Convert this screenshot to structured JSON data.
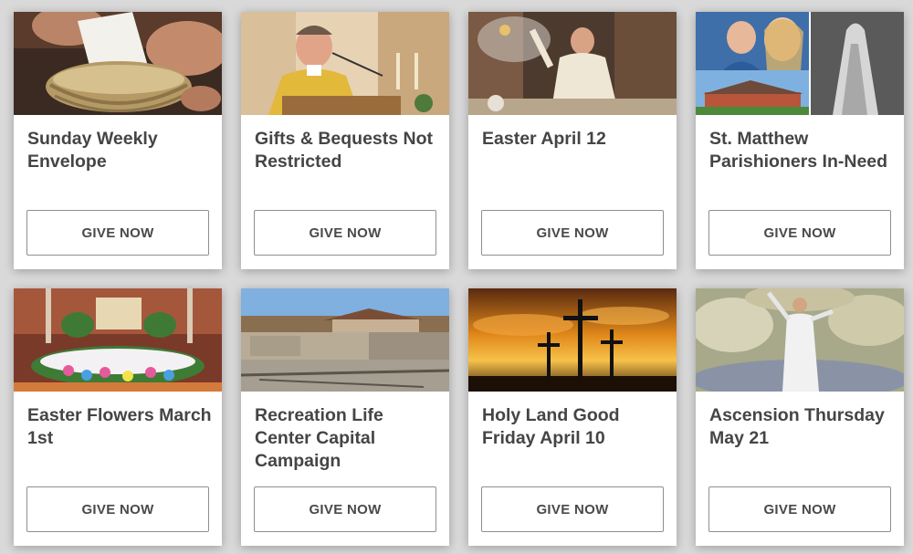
{
  "cards": [
    {
      "title": "Sunday Weekly Envelope",
      "button": "GIVE NOW",
      "image": "offering-basket-photo"
    },
    {
      "title": "Gifts & Bequests Not Restricted",
      "button": "GIVE NOW",
      "image": "priest-at-pulpit-photo"
    },
    {
      "title": "Easter April 12",
      "button": "GIVE NOW",
      "image": "priest-incense-altar-photo"
    },
    {
      "title": "St. Matthew Parishioners In-Need",
      "button": "GIVE NOW",
      "image": "family-church-praying-hands-collage"
    },
    {
      "title": "Easter Flowers March 1st",
      "button": "GIVE NOW",
      "image": "altar-easter-flowers-photo"
    },
    {
      "title": "Recreation Life Center Capital Campaign",
      "button": "GIVE NOW",
      "image": "construction-site-photo"
    },
    {
      "title": "Holy Land Good Friday April 10",
      "button": "GIVE NOW",
      "image": "three-crosses-sunset-photo"
    },
    {
      "title": "Ascension Thursday May 21",
      "button": "GIVE NOW",
      "image": "ascension-painting"
    }
  ]
}
